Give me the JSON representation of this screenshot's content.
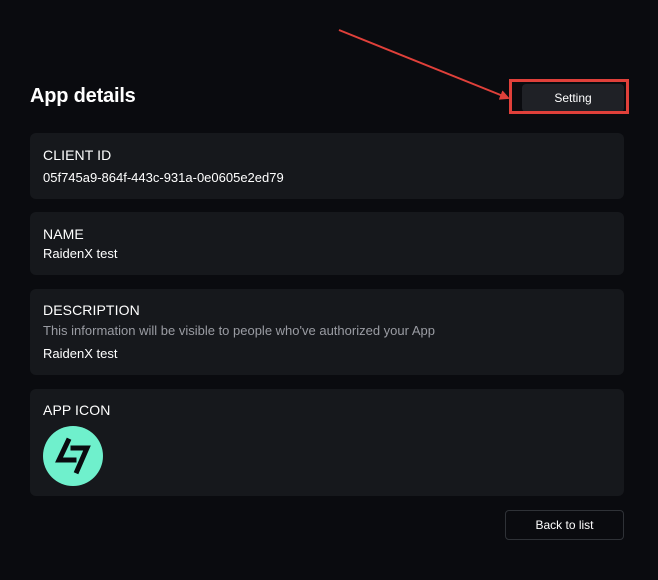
{
  "header": {
    "title": "App details",
    "setting_label": "Setting"
  },
  "client_id": {
    "label": "CLIENT ID",
    "value": "05f745a9-864f-443c-931a-0e0605e2ed79"
  },
  "name": {
    "label": "NAME",
    "value": "RaidenX test"
  },
  "description": {
    "label": "DESCRIPTION",
    "hint": "This information will be visible to people who've authorized your App",
    "value": "RaidenX test"
  },
  "app_icon": {
    "label": "APP ICON",
    "icon": "raidenx-logo-icon",
    "background_color": "#6ff0cc"
  },
  "footer": {
    "back_label": "Back to list"
  },
  "annotation": {
    "color": "#e0403a"
  }
}
